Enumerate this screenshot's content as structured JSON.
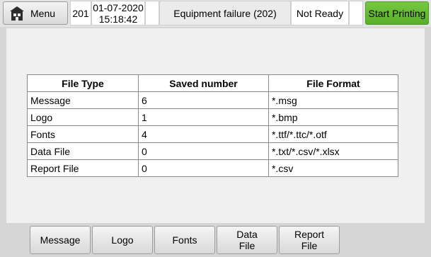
{
  "header": {
    "menu_label": "Menu",
    "printer_id": "201",
    "date": "01-07-2020",
    "time": "15:18:42",
    "status_message": "Equipment failure (202)",
    "printer_state": "Not Ready",
    "start_label": "Start Printing",
    "start_color": "#6abf35",
    "menu_icon": "home-icon"
  },
  "table": {
    "headers": [
      "File Type",
      "Saved number",
      "File Format"
    ],
    "rows": [
      [
        "Message",
        "6",
        "*.msg"
      ],
      [
        "Logo",
        "1",
        "*.bmp"
      ],
      [
        "Fonts",
        "4",
        "*.ttf/*.ttc/*.otf"
      ],
      [
        "Data File",
        "0",
        "*.txt/*.csv/*.xlsx"
      ],
      [
        "Report File",
        "0",
        "*.csv"
      ]
    ]
  },
  "tabs": [
    {
      "line1": "Message",
      "line2": ""
    },
    {
      "line1": "Logo",
      "line2": ""
    },
    {
      "line1": "Fonts",
      "line2": ""
    },
    {
      "line1": "Data",
      "line2": "File"
    },
    {
      "line1": "Report",
      "line2": "File"
    }
  ]
}
